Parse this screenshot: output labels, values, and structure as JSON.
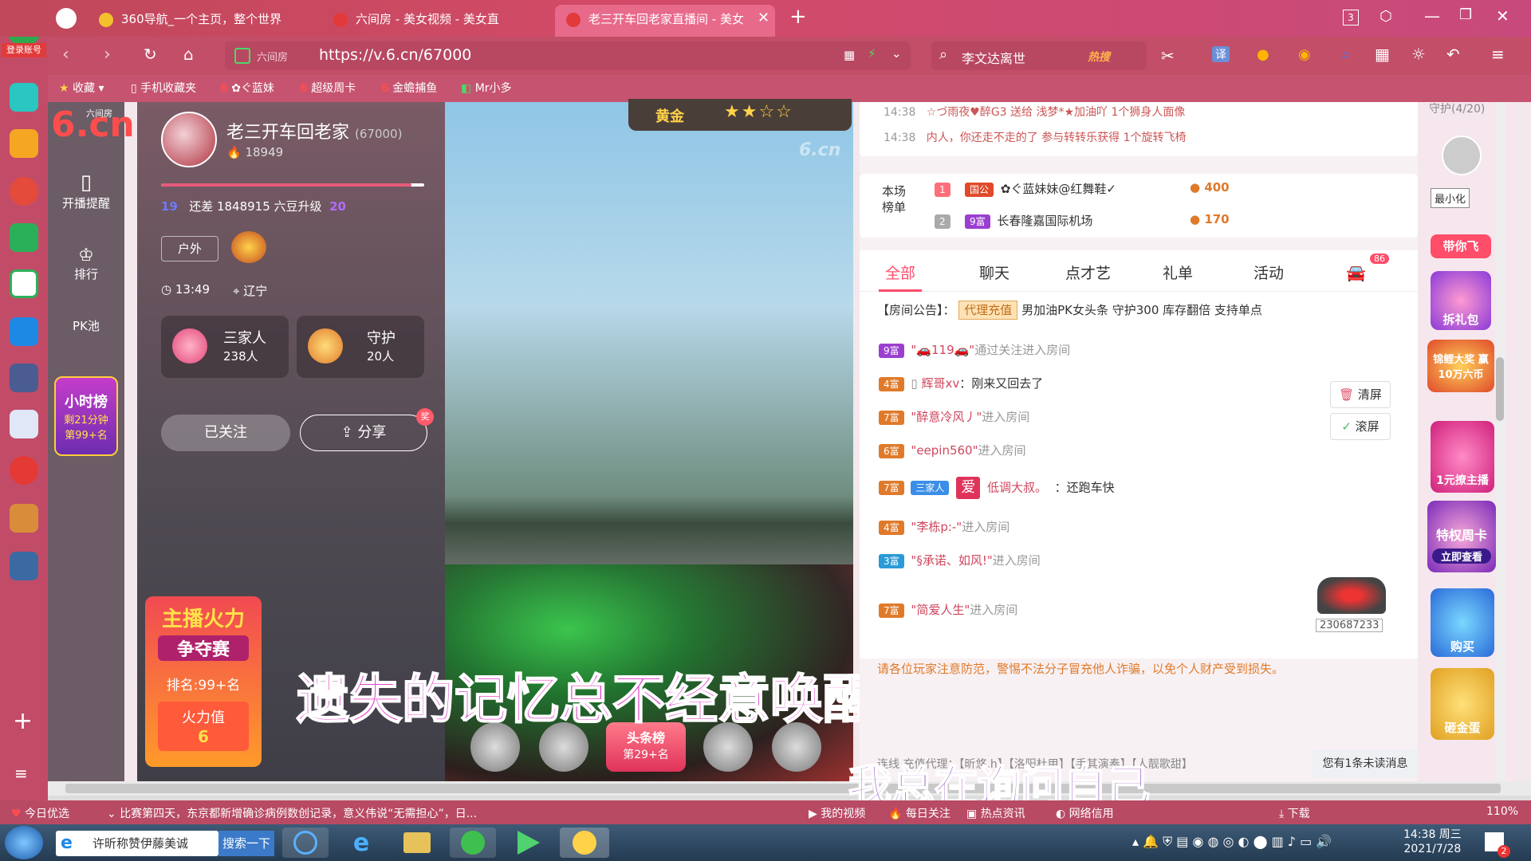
{
  "browser": {
    "login_badge": "登录账号",
    "tabs": [
      {
        "label": "360导航_一个主页，整个世界"
      },
      {
        "label": "六间房 - 美女视频 - 美女直"
      },
      {
        "label": "老三开车回老家直播间 - 美女"
      }
    ],
    "tab_count": "3",
    "address": "https://v.6.cn/67000",
    "site_badge": "六间房",
    "search_text": "李文达离世",
    "search_hot": "热搜",
    "bookmarks": [
      "收藏",
      "手机收藏夹",
      "ぐ蓝妹",
      "超级周卡",
      "金蟾捕鱼",
      "Mr小多"
    ]
  },
  "nav": {
    "logo_sub": "六间房",
    "logo_main": "6.cn",
    "items": [
      {
        "label": "开播提醒"
      },
      {
        "label": "排行"
      },
      {
        "label": "PK池"
      }
    ],
    "hour_rank_title": "小时榜",
    "hour_rank_remaining": "剩21分钟",
    "hour_rank_place": "第99+名"
  },
  "streamer": {
    "name": "老三开车回老家",
    "room_id": "(67000)",
    "fans": "18949",
    "level_from": "19",
    "level_text": "还差 1848915 六豆升级",
    "level_to": "20",
    "tag": "户外",
    "time": "13:49",
    "location": "辽宁",
    "family_label": "三家人",
    "family_count": "238人",
    "guard_label": "守护",
    "guard_count": "20人",
    "follow_btn": "已关注",
    "share_btn": "分享",
    "share_badge": "奖",
    "fire_title": "主播火力",
    "fire_subtitle": "争夺赛",
    "fire_rank": "排名:99+名",
    "fire_value_label": "火力值",
    "fire_value": "6"
  },
  "video": {
    "watermark": "6.cn",
    "badge": "黄金",
    "headline_rank": "头条榜",
    "headline_place": "第29+名",
    "subtitle_1": "遗失的记忆总不经意唤醒",
    "subtitle_2": "我总在询问自己"
  },
  "ticker": [
    {
      "time": "14:38",
      "text": "☆づ雨夜♥醉G3 送给 浅梦*★加油吖 1个狮身人面像"
    },
    {
      "time": "14:38",
      "text": "内人，你还走不走的了 参与转转乐获得 1个旋转飞椅"
    }
  ],
  "ranking": {
    "title": "本场榜单",
    "rows": [
      {
        "rank": "1",
        "badge": "国公",
        "name": "✿ぐ蓝妹妹@红舞鞋✓",
        "score": "400"
      },
      {
        "rank": "2",
        "badge": "9富",
        "name": "长春隆嘉国际机场",
        "score": "170"
      }
    ]
  },
  "chat_tabs": [
    "全部",
    "聊天",
    "点才艺",
    "礼单",
    "活动"
  ],
  "car_count": "86",
  "announcement": {
    "prefix": "【房间公告】：",
    "tag": "代理充值",
    "text": "男加油PK女头条 守护300 库存翻倍 支持单点"
  },
  "chat": [
    {
      "lvl": "9富",
      "color": "#9b3fd0",
      "name": "\"🚗119🚗\"",
      "text": "通过关注进入房间"
    },
    {
      "lvl": "4富",
      "color": "#e07a2a",
      "name": "辉哥xv",
      "text": "：刚来又回去了"
    },
    {
      "lvl": "7富",
      "color": "#e07a2a",
      "name": "\"醉意冷风丿\"",
      "text": "进入房间"
    },
    {
      "lvl": "6富",
      "color": "#e07a2a",
      "name": "\"eepin560\"",
      "text": "进入房间"
    },
    {
      "lvl": "7富",
      "color": "#e07a2a",
      "name": "低调大叔。",
      "text": "：还跑车快",
      "family": "三家人",
      "love": "爱"
    },
    {
      "lvl": "4富",
      "color": "#e07a2a",
      "name": "\"李栋p:-\"",
      "text": "进入房间"
    },
    {
      "lvl": "3富",
      "color": "#2a9ad8",
      "name": "\"§承诺、如风!\"",
      "text": "进入房间"
    },
    {
      "lvl": "7富",
      "color": "#e07a2a",
      "name": "\"简爱人生\"",
      "text": "进入房间"
    }
  ],
  "clear_btn": "清屏",
  "scroll_btn": "滚屏",
  "car_id": "230687233",
  "warning": "请各位玩家注意防范，警惕不法分子冒充他人诈骗，以免个人财产受到损失。",
  "bottom_links": "连线   充值代理：【昕悠.h】【洛阳杜甲】【手其演奏】【人靓歌甜】",
  "unread": "您有1条未读消息",
  "right_panel": {
    "guard_count": "守护(4/20)",
    "minimize": "最小化",
    "items": [
      "带你飞",
      "拆礼包",
      "锦鲤大奖 赢10万六币",
      "1元撩主播",
      "特权周卡",
      "立即查看",
      "购买",
      "砸金蛋"
    ]
  },
  "statusbar": {
    "pick": "今日优选",
    "news": "比赛第四天，东京都新增确诊病例数创记录，意义伟说“无需担心”，日...",
    "items": [
      "我的视频",
      "每日关注",
      "热点资讯",
      "网络信用",
      "下载"
    ],
    "zoom": "110%"
  },
  "taskbar": {
    "ie_label": "许昕称赞伊藤美诚",
    "search_btn": "搜索一下",
    "time": "14:38 周三",
    "date": "2021/7/28",
    "notif": "2"
  }
}
